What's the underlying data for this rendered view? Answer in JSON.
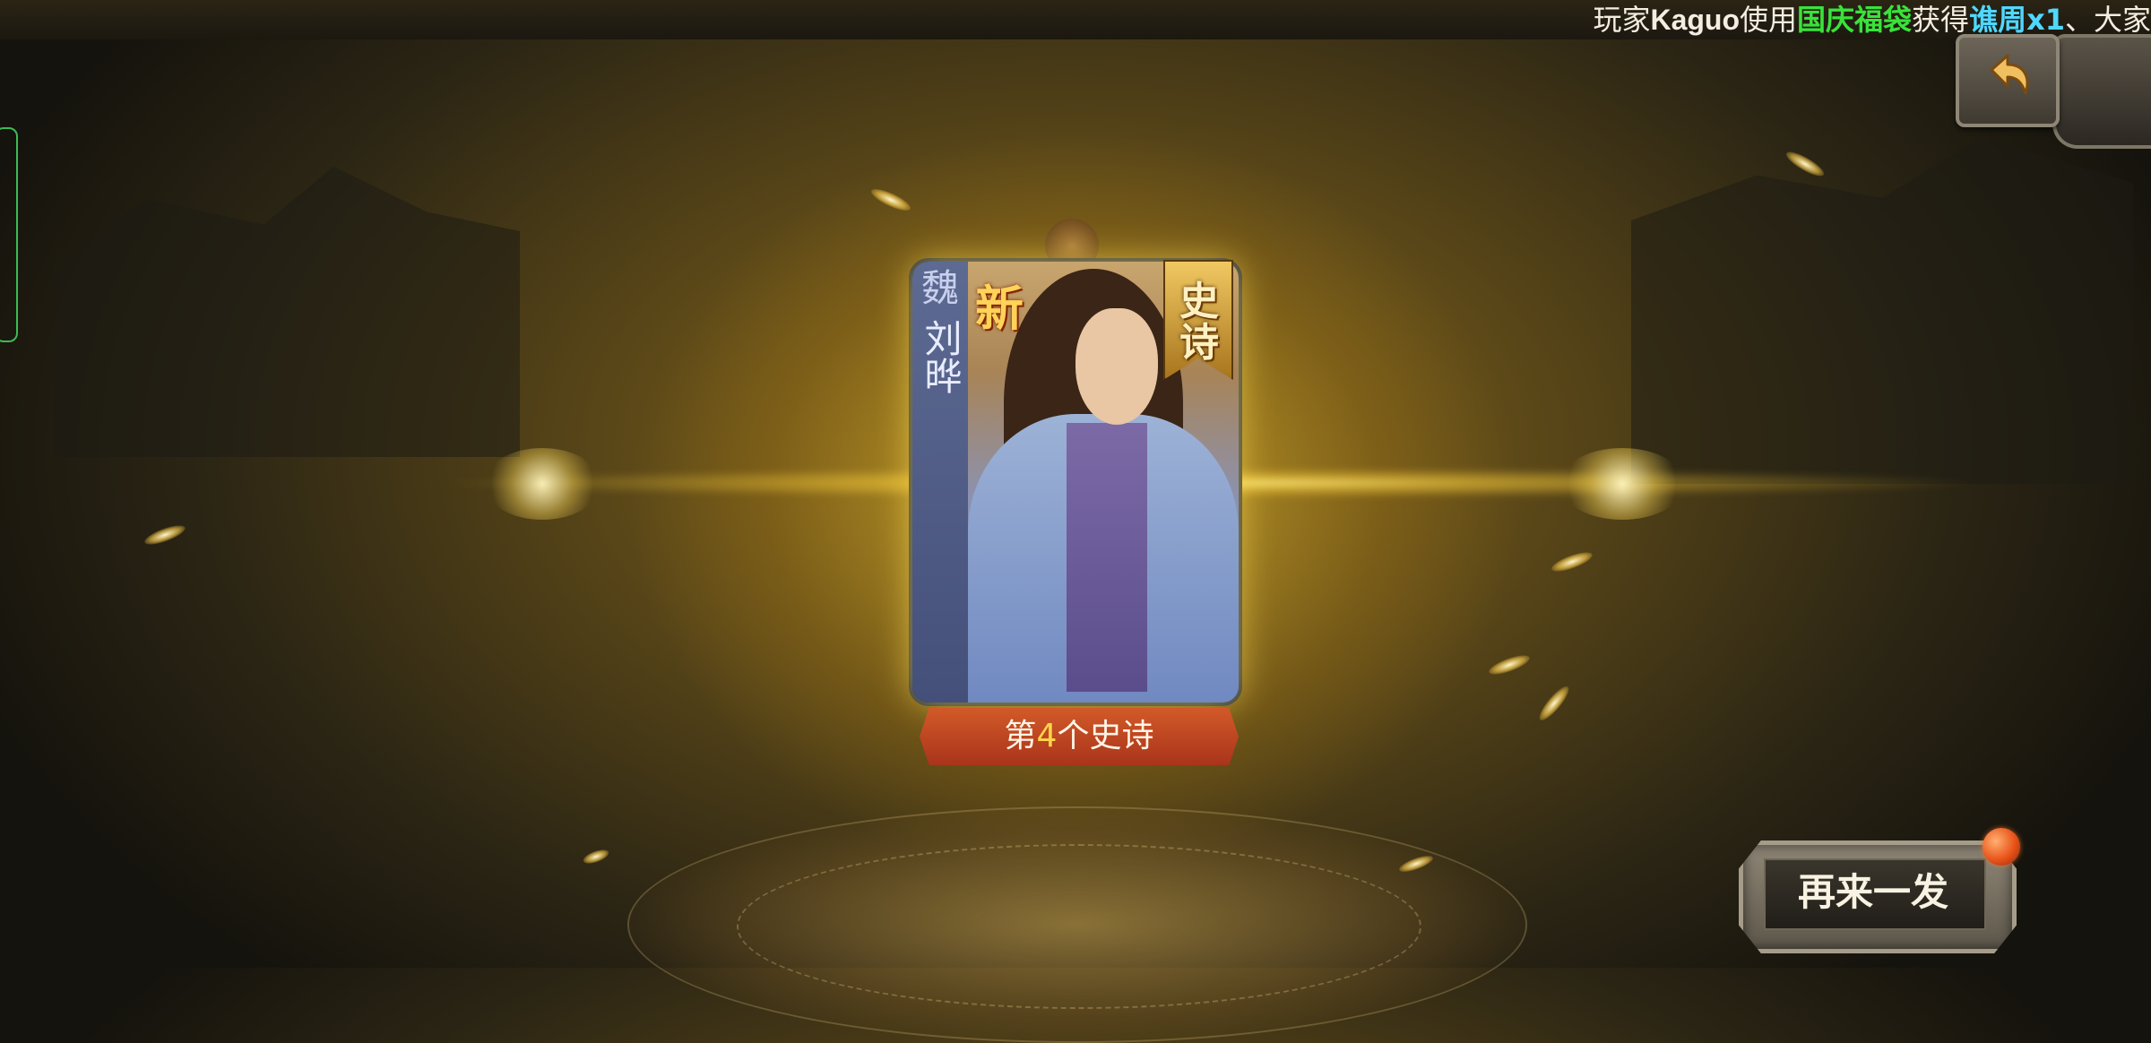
{
  "marquee": {
    "prefix": "玩家",
    "player": "Kaguo",
    "verb": "使用",
    "item": "国庆福袋",
    "got": "获得",
    "reward": "谯周x1",
    "suffix": "、大家"
  },
  "card": {
    "faction": "魏",
    "hero_name": "刘晔",
    "new_tag": "新",
    "rarity_badge": "史诗"
  },
  "epic_count": {
    "prefix": "第",
    "number": "4",
    "suffix": "个史诗"
  },
  "buttons": {
    "retry_label": "再来一发",
    "back_icon": "back-arrow-icon"
  },
  "colors": {
    "item_highlight": "#39e33a",
    "reward_highlight": "#4fd8ff",
    "count_number": "#ffd54a",
    "ribbon": "#c0441f",
    "notification_dot": "#e9531a"
  }
}
